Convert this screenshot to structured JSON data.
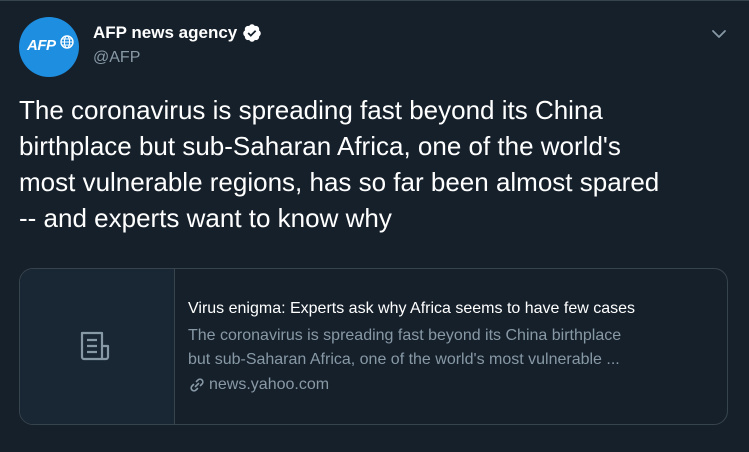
{
  "tweet": {
    "author": {
      "display_name": "AFP news agency",
      "handle": "@AFP",
      "avatar_text": "AFP",
      "avatar_color": "#1d8ee0",
      "verified": true
    },
    "text": "The coronavirus is spreading fast beyond its China\nbirthplace but sub-Saharan Africa, one of the world's\nmost vulnerable regions, has so far been almost spared\n-- and experts want to know why",
    "more_icon": "chevron-down-icon"
  },
  "card": {
    "thumbnail_icon": "article-icon",
    "title": "Virus enigma: Experts ask why Africa seems to have few cases",
    "description": "The coronavirus is spreading fast beyond its China birthplace\nbut sub-Saharan Africa, one of the world's most vulnerable ...",
    "domain": "news.yahoo.com",
    "link_icon": "link-icon"
  },
  "colors": {
    "background": "#15202b",
    "border": "#38444d",
    "secondary_text": "#8899a6",
    "primary_text": "#ffffff"
  }
}
